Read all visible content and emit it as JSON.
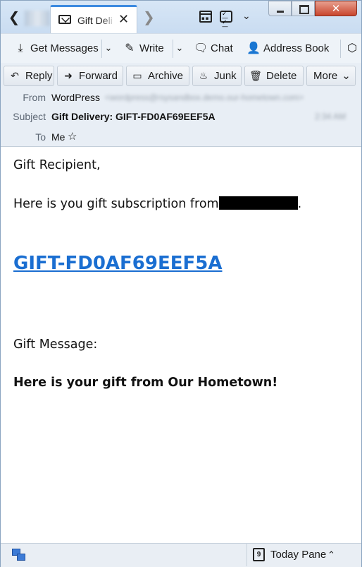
{
  "window": {
    "tab_title": "Gift Delivery",
    "buttons": {
      "minimize": "minimize",
      "maximize": "maximize",
      "close": "✕"
    }
  },
  "toolbar": {
    "get_messages": "Get Messages",
    "write": "Write",
    "chat": "Chat",
    "address_book": "Address Book"
  },
  "header_actions": {
    "reply": "Reply",
    "forward": "Forward",
    "archive": "Archive",
    "junk": "Junk",
    "delete": "Delete",
    "more": "More"
  },
  "headers": {
    "from_label": "From",
    "from_name": "WordPress",
    "from_email": "<wordpress@rsysandbox.demo.our-hometown.com>",
    "subject_label": "Subject",
    "subject": "Gift Delivery: GIFT-FD0AF69EEF5A",
    "time": "2:34 AM",
    "to_label": "To",
    "to": "Me"
  },
  "message": {
    "greeting": "Gift Recipient,",
    "intro": "Here is you gift subscription from",
    "intro_end": ".",
    "gift_code": "GIFT-FD0AF69EEF5A",
    "gift_message_label": "Gift Message:",
    "gift_message": "Here is your gift from Our Hometown!"
  },
  "statusbar": {
    "today_pane": "Today Pane",
    "calendar_day": "9"
  },
  "colors": {
    "accent": "#3d8be0",
    "link": "#1a6ed1",
    "close_button": "#c9452d"
  },
  "icons": [
    "back-arrow-icon",
    "mail-icon",
    "tab-close-icon",
    "tab-next-icon",
    "calendar-icon",
    "tasks-icon",
    "app-menu-chevron-icon",
    "get-messages-icon",
    "pencil-icon",
    "chat-icon",
    "address-book-icon",
    "tag-icon",
    "reply-icon",
    "forward-icon",
    "archive-icon",
    "junk-icon",
    "trash-icon",
    "star-icon",
    "network-icon"
  ]
}
